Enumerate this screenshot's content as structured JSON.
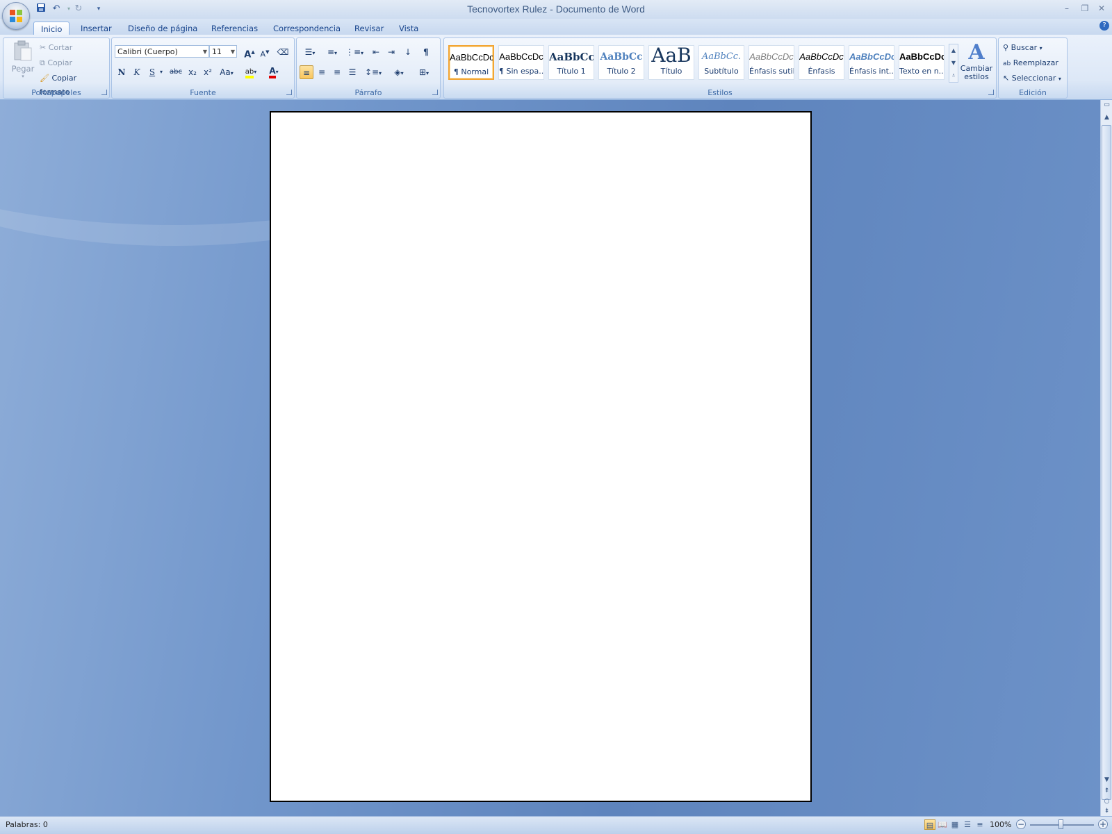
{
  "window": {
    "title": "Tecnovortex Rulez - Documento de Word",
    "minimize_icon": "minimize-icon",
    "restore_icon": "restore-icon",
    "close_icon": "close-icon"
  },
  "quick_access": {
    "save_icon": "save-icon",
    "undo_icon": "undo-icon",
    "redo_icon": "redo-icon",
    "customize_icon": "dropdown-icon"
  },
  "tabs": [
    {
      "label": "Inicio",
      "active": true
    },
    {
      "label": "Insertar"
    },
    {
      "label": "Diseño de página"
    },
    {
      "label": "Referencias"
    },
    {
      "label": "Correspondencia"
    },
    {
      "label": "Revisar"
    },
    {
      "label": "Vista"
    }
  ],
  "clipboard": {
    "label": "Portapapeles",
    "paste": "Pegar",
    "cut": "Cortar",
    "copy": "Copiar",
    "format_painter": "Copiar formato"
  },
  "font": {
    "label": "Fuente",
    "family": "Calibri (Cuerpo)",
    "size": "11",
    "bold": "N",
    "italic": "K",
    "underline": "S",
    "strikethrough": "abc",
    "subscript": "x₂",
    "superscript": "x²",
    "change_case": "Aa",
    "grow": "A",
    "shrink": "A",
    "highlight": "ab",
    "font_color": "A",
    "highlight_color": "#ffff00",
    "font_color_value": "#e00000"
  },
  "paragraph": {
    "label": "Párrafo",
    "show_marks": "¶"
  },
  "styles": {
    "label": "Estilos",
    "items": [
      {
        "preview": "AaBbCcDc",
        "name": "¶ Normal",
        "selected": true
      },
      {
        "preview": "AaBbCcDc",
        "name": "¶ Sin espa..."
      },
      {
        "preview": "AaBbCc",
        "name": "Título 1"
      },
      {
        "preview": "AaBbCc",
        "name": "Título 2"
      },
      {
        "preview": "AaB",
        "name": "Título"
      },
      {
        "preview": "AaBbCc.",
        "name": "Subtítulo"
      },
      {
        "preview": "AaBbCcDc",
        "name": "Énfasis sutil"
      },
      {
        "preview": "AaBbCcDc",
        "name": "Énfasis"
      },
      {
        "preview": "AaBbCcDc",
        "name": "Énfasis int..."
      },
      {
        "preview": "AaBbCcDc",
        "name": "Texto en n..."
      }
    ],
    "change_styles": "Cambiar estilos"
  },
  "editing": {
    "label": "Edición",
    "find": "Buscar",
    "replace": "Reemplazar",
    "select": "Seleccionar"
  },
  "status": {
    "words": "Palabras: 0",
    "zoom": "100%",
    "zoom_out": "−",
    "zoom_in": "+"
  }
}
